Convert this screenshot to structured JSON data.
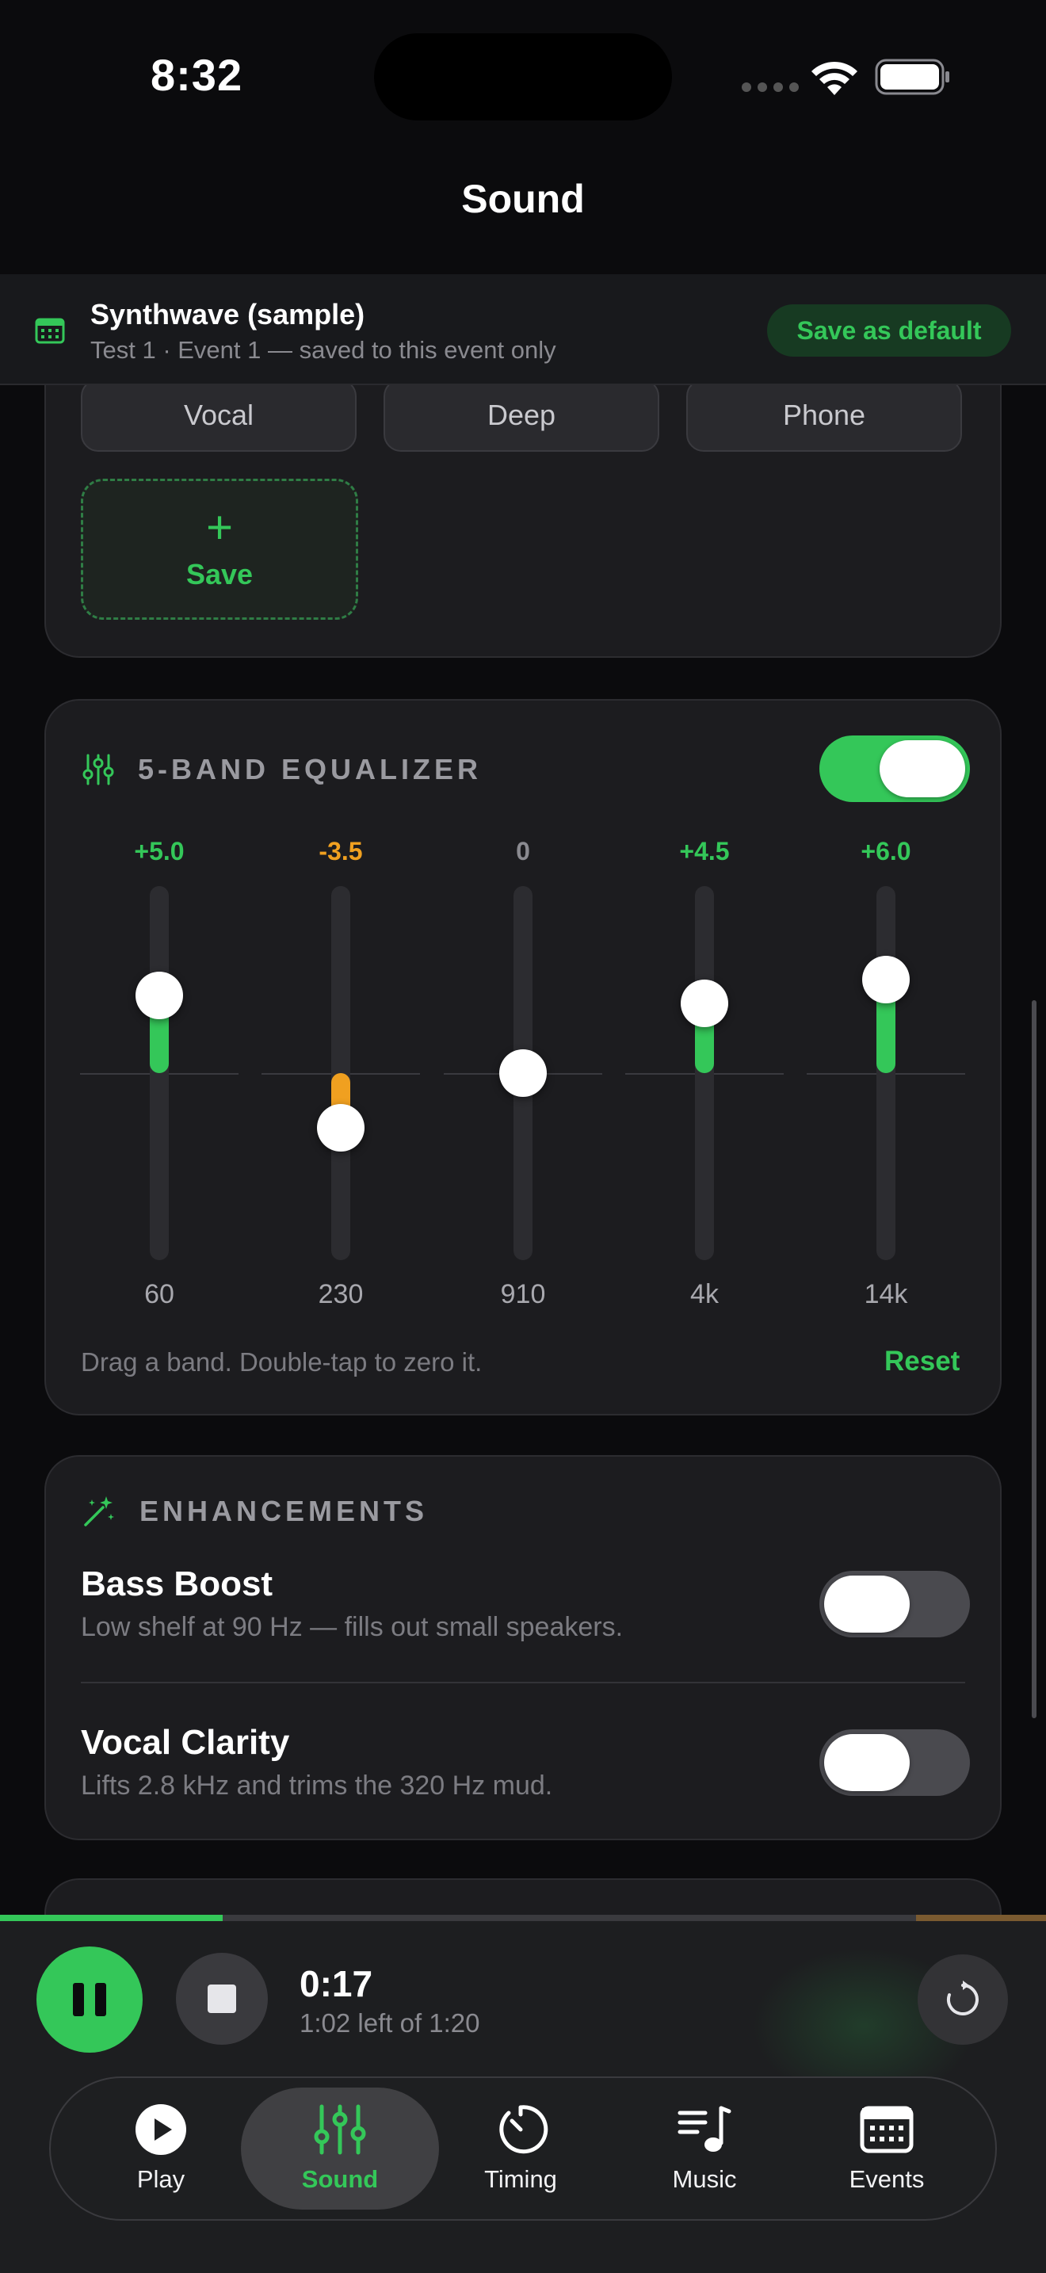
{
  "status_bar": {
    "time": "8:32"
  },
  "nav": {
    "title": "Sound"
  },
  "banner": {
    "title": "Synthwave (sample)",
    "subtitle": "Test 1 · Event 1 — saved to this event only",
    "save_default_label": "Save as default",
    "icon": "calendar-icon"
  },
  "presets": {
    "items": [
      "Vocal",
      "Deep",
      "Phone"
    ],
    "save_icon": "+",
    "save_label": "Save"
  },
  "equalizer": {
    "title": "5-BAND EQUALIZER",
    "enabled": true,
    "range_db": [
      -12,
      12
    ],
    "bands": [
      {
        "freq": "60",
        "value_label": "+5.0",
        "gain": 5.0
      },
      {
        "freq": "230",
        "value_label": "-3.5",
        "gain": -3.5
      },
      {
        "freq": "910",
        "value_label": "0",
        "gain": 0
      },
      {
        "freq": "4k",
        "value_label": "+4.5",
        "gain": 4.5
      },
      {
        "freq": "14k",
        "value_label": "+6.0",
        "gain": 6.0
      }
    ],
    "hint": "Drag a band. Double-tap to zero it.",
    "reset_label": "Reset",
    "colors": {
      "positive": "#34c759",
      "negative": "#f0a020",
      "neutral": "#8a8a90"
    }
  },
  "enhancements": {
    "title": "ENHANCEMENTS",
    "items": [
      {
        "name": "Bass Boost",
        "description": "Low shelf at 90 Hz — fills out small speakers.",
        "enabled": false
      },
      {
        "name": "Vocal Clarity",
        "description": "Lifts 2.8 kHz and trims the 320 Hz mud.",
        "enabled": false
      }
    ]
  },
  "player": {
    "elapsed": "0:17",
    "remaining": "1:02 left of 1:20",
    "progress": 0.2125
  },
  "tabs": [
    {
      "label": "Play",
      "icon": "play-icon",
      "active": false
    },
    {
      "label": "Sound",
      "icon": "sliders-icon",
      "active": true
    },
    {
      "label": "Timing",
      "icon": "timer-icon",
      "active": false
    },
    {
      "label": "Music",
      "icon": "music-list-icon",
      "active": false
    },
    {
      "label": "Events",
      "icon": "calendar-icon",
      "active": false
    }
  ],
  "accent_color": "#34c759"
}
